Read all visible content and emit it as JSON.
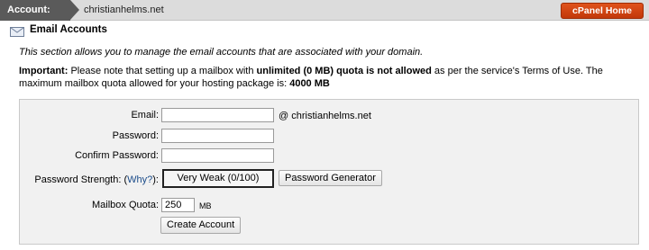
{
  "topbar": {
    "account_label": "Account:",
    "domain": "christianhelms.net",
    "home_button": "cPanel Home",
    "accent_color": "#d6461a"
  },
  "section": {
    "icon": "mail-icon",
    "title": "Email Accounts",
    "description": "This section allows you to manage the email accounts that are associated with your domain."
  },
  "notice": {
    "important_label": "Important:",
    "text_1": " Please note that setting up a mailbox with ",
    "bold_1": "unlimited (0 MB) quota is not allowed",
    "text_2": " as per the service's Terms of Use. The maximum mailbox quota allowed for your hosting package is: ",
    "bold_2": "4000 MB"
  },
  "form": {
    "email_label": "Email:",
    "email_value": "",
    "email_domain_suffix": "@ christianhelms.net",
    "password_label": "Password:",
    "password_value": "",
    "confirm_label": "Confirm Password:",
    "confirm_value": "",
    "strength_label_prefix": "Password Strength: (",
    "why_link": "Why?",
    "strength_label_suffix": "):",
    "strength_value": "Very Weak (0/100)",
    "generator_button": "Password Generator",
    "quota_label": "Mailbox Quota:",
    "quota_value": "250",
    "quota_unit": "MB",
    "submit_button": "Create Account"
  }
}
